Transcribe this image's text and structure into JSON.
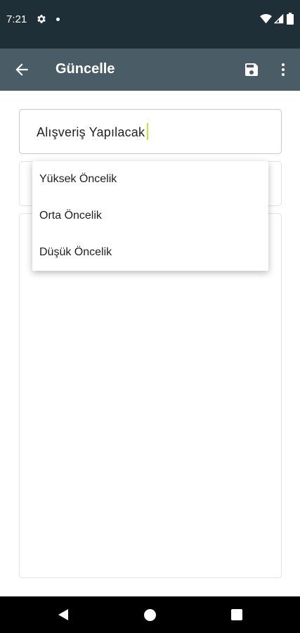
{
  "status_bar": {
    "time": "7:21",
    "icons": [
      "gear-icon",
      "dot",
      "wifi-icon",
      "signal-icon",
      "battery-icon"
    ]
  },
  "app_bar": {
    "title": "Güncelle",
    "icons": [
      "back-arrow-icon",
      "save-icon",
      "more-vert-icon"
    ]
  },
  "form": {
    "title_value": "Alışveriş Yapılacak",
    "caret_color": "#c6e32b"
  },
  "dropdown": {
    "options": [
      "Yüksek Öncelik",
      "Orta Öncelik",
      "Düşük Öncelik"
    ]
  },
  "nav_bar": {
    "buttons": [
      "nav-back-icon",
      "nav-home-icon",
      "nav-recents-icon"
    ]
  },
  "colors": {
    "status_bar": "#1f2f38",
    "app_bar": "#4a5d66",
    "background": "#ffffff"
  }
}
